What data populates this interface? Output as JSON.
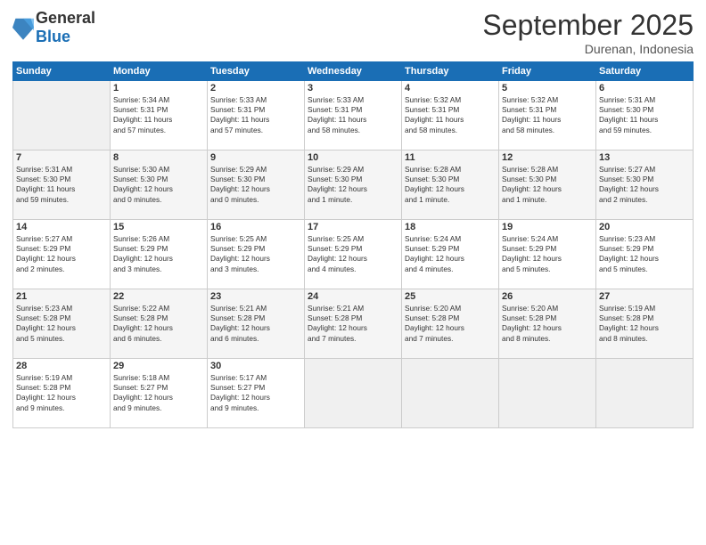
{
  "header": {
    "logo_general": "General",
    "logo_blue": "Blue",
    "month_year": "September 2025",
    "location": "Durenan, Indonesia"
  },
  "days_of_week": [
    "Sunday",
    "Monday",
    "Tuesday",
    "Wednesday",
    "Thursday",
    "Friday",
    "Saturday"
  ],
  "weeks": [
    [
      {
        "day": "",
        "info": ""
      },
      {
        "day": "1",
        "info": "Sunrise: 5:34 AM\nSunset: 5:31 PM\nDaylight: 11 hours\nand 57 minutes."
      },
      {
        "day": "2",
        "info": "Sunrise: 5:33 AM\nSunset: 5:31 PM\nDaylight: 11 hours\nand 57 minutes."
      },
      {
        "day": "3",
        "info": "Sunrise: 5:33 AM\nSunset: 5:31 PM\nDaylight: 11 hours\nand 58 minutes."
      },
      {
        "day": "4",
        "info": "Sunrise: 5:32 AM\nSunset: 5:31 PM\nDaylight: 11 hours\nand 58 minutes."
      },
      {
        "day": "5",
        "info": "Sunrise: 5:32 AM\nSunset: 5:31 PM\nDaylight: 11 hours\nand 58 minutes."
      },
      {
        "day": "6",
        "info": "Sunrise: 5:31 AM\nSunset: 5:30 PM\nDaylight: 11 hours\nand 59 minutes."
      }
    ],
    [
      {
        "day": "7",
        "info": "Sunrise: 5:31 AM\nSunset: 5:30 PM\nDaylight: 11 hours\nand 59 minutes."
      },
      {
        "day": "8",
        "info": "Sunrise: 5:30 AM\nSunset: 5:30 PM\nDaylight: 12 hours\nand 0 minutes."
      },
      {
        "day": "9",
        "info": "Sunrise: 5:29 AM\nSunset: 5:30 PM\nDaylight: 12 hours\nand 0 minutes."
      },
      {
        "day": "10",
        "info": "Sunrise: 5:29 AM\nSunset: 5:30 PM\nDaylight: 12 hours\nand 1 minute."
      },
      {
        "day": "11",
        "info": "Sunrise: 5:28 AM\nSunset: 5:30 PM\nDaylight: 12 hours\nand 1 minute."
      },
      {
        "day": "12",
        "info": "Sunrise: 5:28 AM\nSunset: 5:30 PM\nDaylight: 12 hours\nand 1 minute."
      },
      {
        "day": "13",
        "info": "Sunrise: 5:27 AM\nSunset: 5:30 PM\nDaylight: 12 hours\nand 2 minutes."
      }
    ],
    [
      {
        "day": "14",
        "info": "Sunrise: 5:27 AM\nSunset: 5:29 PM\nDaylight: 12 hours\nand 2 minutes."
      },
      {
        "day": "15",
        "info": "Sunrise: 5:26 AM\nSunset: 5:29 PM\nDaylight: 12 hours\nand 3 minutes."
      },
      {
        "day": "16",
        "info": "Sunrise: 5:25 AM\nSunset: 5:29 PM\nDaylight: 12 hours\nand 3 minutes."
      },
      {
        "day": "17",
        "info": "Sunrise: 5:25 AM\nSunset: 5:29 PM\nDaylight: 12 hours\nand 4 minutes."
      },
      {
        "day": "18",
        "info": "Sunrise: 5:24 AM\nSunset: 5:29 PM\nDaylight: 12 hours\nand 4 minutes."
      },
      {
        "day": "19",
        "info": "Sunrise: 5:24 AM\nSunset: 5:29 PM\nDaylight: 12 hours\nand 5 minutes."
      },
      {
        "day": "20",
        "info": "Sunrise: 5:23 AM\nSunset: 5:29 PM\nDaylight: 12 hours\nand 5 minutes."
      }
    ],
    [
      {
        "day": "21",
        "info": "Sunrise: 5:23 AM\nSunset: 5:28 PM\nDaylight: 12 hours\nand 5 minutes."
      },
      {
        "day": "22",
        "info": "Sunrise: 5:22 AM\nSunset: 5:28 PM\nDaylight: 12 hours\nand 6 minutes."
      },
      {
        "day": "23",
        "info": "Sunrise: 5:21 AM\nSunset: 5:28 PM\nDaylight: 12 hours\nand 6 minutes."
      },
      {
        "day": "24",
        "info": "Sunrise: 5:21 AM\nSunset: 5:28 PM\nDaylight: 12 hours\nand 7 minutes."
      },
      {
        "day": "25",
        "info": "Sunrise: 5:20 AM\nSunset: 5:28 PM\nDaylight: 12 hours\nand 7 minutes."
      },
      {
        "day": "26",
        "info": "Sunrise: 5:20 AM\nSunset: 5:28 PM\nDaylight: 12 hours\nand 8 minutes."
      },
      {
        "day": "27",
        "info": "Sunrise: 5:19 AM\nSunset: 5:28 PM\nDaylight: 12 hours\nand 8 minutes."
      }
    ],
    [
      {
        "day": "28",
        "info": "Sunrise: 5:19 AM\nSunset: 5:28 PM\nDaylight: 12 hours\nand 9 minutes."
      },
      {
        "day": "29",
        "info": "Sunrise: 5:18 AM\nSunset: 5:27 PM\nDaylight: 12 hours\nand 9 minutes."
      },
      {
        "day": "30",
        "info": "Sunrise: 5:17 AM\nSunset: 5:27 PM\nDaylight: 12 hours\nand 9 minutes."
      },
      {
        "day": "",
        "info": ""
      },
      {
        "day": "",
        "info": ""
      },
      {
        "day": "",
        "info": ""
      },
      {
        "day": "",
        "info": ""
      }
    ]
  ]
}
